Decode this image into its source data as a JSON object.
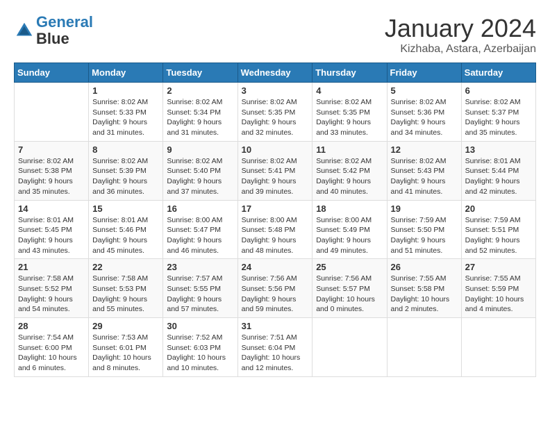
{
  "header": {
    "logo_line1": "General",
    "logo_line2": "Blue",
    "month_title": "January 2024",
    "location": "Kizhaba, Astara, Azerbaijan"
  },
  "days_of_week": [
    "Sunday",
    "Monday",
    "Tuesday",
    "Wednesday",
    "Thursday",
    "Friday",
    "Saturday"
  ],
  "weeks": [
    [
      {
        "day": "",
        "info": ""
      },
      {
        "day": "1",
        "info": "Sunrise: 8:02 AM\nSunset: 5:33 PM\nDaylight: 9 hours\nand 31 minutes."
      },
      {
        "day": "2",
        "info": "Sunrise: 8:02 AM\nSunset: 5:34 PM\nDaylight: 9 hours\nand 31 minutes."
      },
      {
        "day": "3",
        "info": "Sunrise: 8:02 AM\nSunset: 5:35 PM\nDaylight: 9 hours\nand 32 minutes."
      },
      {
        "day": "4",
        "info": "Sunrise: 8:02 AM\nSunset: 5:35 PM\nDaylight: 9 hours\nand 33 minutes."
      },
      {
        "day": "5",
        "info": "Sunrise: 8:02 AM\nSunset: 5:36 PM\nDaylight: 9 hours\nand 34 minutes."
      },
      {
        "day": "6",
        "info": "Sunrise: 8:02 AM\nSunset: 5:37 PM\nDaylight: 9 hours\nand 35 minutes."
      }
    ],
    [
      {
        "day": "7",
        "info": "Sunrise: 8:02 AM\nSunset: 5:38 PM\nDaylight: 9 hours\nand 35 minutes."
      },
      {
        "day": "8",
        "info": "Sunrise: 8:02 AM\nSunset: 5:39 PM\nDaylight: 9 hours\nand 36 minutes."
      },
      {
        "day": "9",
        "info": "Sunrise: 8:02 AM\nSunset: 5:40 PM\nDaylight: 9 hours\nand 37 minutes."
      },
      {
        "day": "10",
        "info": "Sunrise: 8:02 AM\nSunset: 5:41 PM\nDaylight: 9 hours\nand 39 minutes."
      },
      {
        "day": "11",
        "info": "Sunrise: 8:02 AM\nSunset: 5:42 PM\nDaylight: 9 hours\nand 40 minutes."
      },
      {
        "day": "12",
        "info": "Sunrise: 8:02 AM\nSunset: 5:43 PM\nDaylight: 9 hours\nand 41 minutes."
      },
      {
        "day": "13",
        "info": "Sunrise: 8:01 AM\nSunset: 5:44 PM\nDaylight: 9 hours\nand 42 minutes."
      }
    ],
    [
      {
        "day": "14",
        "info": "Sunrise: 8:01 AM\nSunset: 5:45 PM\nDaylight: 9 hours\nand 43 minutes."
      },
      {
        "day": "15",
        "info": "Sunrise: 8:01 AM\nSunset: 5:46 PM\nDaylight: 9 hours\nand 45 minutes."
      },
      {
        "day": "16",
        "info": "Sunrise: 8:00 AM\nSunset: 5:47 PM\nDaylight: 9 hours\nand 46 minutes."
      },
      {
        "day": "17",
        "info": "Sunrise: 8:00 AM\nSunset: 5:48 PM\nDaylight: 9 hours\nand 48 minutes."
      },
      {
        "day": "18",
        "info": "Sunrise: 8:00 AM\nSunset: 5:49 PM\nDaylight: 9 hours\nand 49 minutes."
      },
      {
        "day": "19",
        "info": "Sunrise: 7:59 AM\nSunset: 5:50 PM\nDaylight: 9 hours\nand 51 minutes."
      },
      {
        "day": "20",
        "info": "Sunrise: 7:59 AM\nSunset: 5:51 PM\nDaylight: 9 hours\nand 52 minutes."
      }
    ],
    [
      {
        "day": "21",
        "info": "Sunrise: 7:58 AM\nSunset: 5:52 PM\nDaylight: 9 hours\nand 54 minutes."
      },
      {
        "day": "22",
        "info": "Sunrise: 7:58 AM\nSunset: 5:53 PM\nDaylight: 9 hours\nand 55 minutes."
      },
      {
        "day": "23",
        "info": "Sunrise: 7:57 AM\nSunset: 5:55 PM\nDaylight: 9 hours\nand 57 minutes."
      },
      {
        "day": "24",
        "info": "Sunrise: 7:56 AM\nSunset: 5:56 PM\nDaylight: 9 hours\nand 59 minutes."
      },
      {
        "day": "25",
        "info": "Sunrise: 7:56 AM\nSunset: 5:57 PM\nDaylight: 10 hours\nand 0 minutes."
      },
      {
        "day": "26",
        "info": "Sunrise: 7:55 AM\nSunset: 5:58 PM\nDaylight: 10 hours\nand 2 minutes."
      },
      {
        "day": "27",
        "info": "Sunrise: 7:55 AM\nSunset: 5:59 PM\nDaylight: 10 hours\nand 4 minutes."
      }
    ],
    [
      {
        "day": "28",
        "info": "Sunrise: 7:54 AM\nSunset: 6:00 PM\nDaylight: 10 hours\nand 6 minutes."
      },
      {
        "day": "29",
        "info": "Sunrise: 7:53 AM\nSunset: 6:01 PM\nDaylight: 10 hours\nand 8 minutes."
      },
      {
        "day": "30",
        "info": "Sunrise: 7:52 AM\nSunset: 6:03 PM\nDaylight: 10 hours\nand 10 minutes."
      },
      {
        "day": "31",
        "info": "Sunrise: 7:51 AM\nSunset: 6:04 PM\nDaylight: 10 hours\nand 12 minutes."
      },
      {
        "day": "",
        "info": ""
      },
      {
        "day": "",
        "info": ""
      },
      {
        "day": "",
        "info": ""
      }
    ]
  ]
}
